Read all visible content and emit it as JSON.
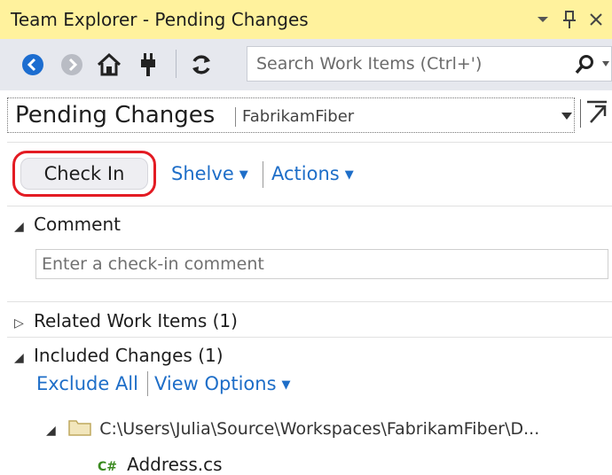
{
  "window": {
    "title": "Team Explorer - Pending Changes"
  },
  "toolbar": {
    "search_placeholder": "Search Work Items (Ctrl+')"
  },
  "header": {
    "title": "Pending Changes",
    "project": "FabrikamFiber"
  },
  "actions": {
    "check_in_label": "Check In",
    "shelve_label": "Shelve",
    "actions_label": "Actions"
  },
  "comment_section": {
    "title": "Comment",
    "placeholder": "Enter a check-in comment"
  },
  "related_section": {
    "title": "Related Work Items (1)"
  },
  "included_section": {
    "title": "Included Changes (1)",
    "exclude_all_label": "Exclude All",
    "view_options_label": "View Options",
    "folder_path": "C:\\Users\\Julia\\Source\\Workspaces\\FabrikamFiber\\D...",
    "file_badge": "C#",
    "file_name": "Address.cs"
  },
  "colors": {
    "titlebar_bg": "#fff29d",
    "toolbar_bg": "#e6e8ee",
    "link": "#1e6ec8",
    "highlight_ring": "#e31b23",
    "back_button": "#1c6dd0"
  },
  "icons": {
    "titlebar": [
      "dropdown-arrow-icon",
      "pin-icon",
      "close-icon"
    ],
    "toolbar": [
      "back-icon",
      "forward-icon",
      "home-icon",
      "connect-icon",
      "refresh-icon",
      "search-icon"
    ],
    "tree": [
      "folder-icon",
      "csharp-file-icon"
    ]
  }
}
